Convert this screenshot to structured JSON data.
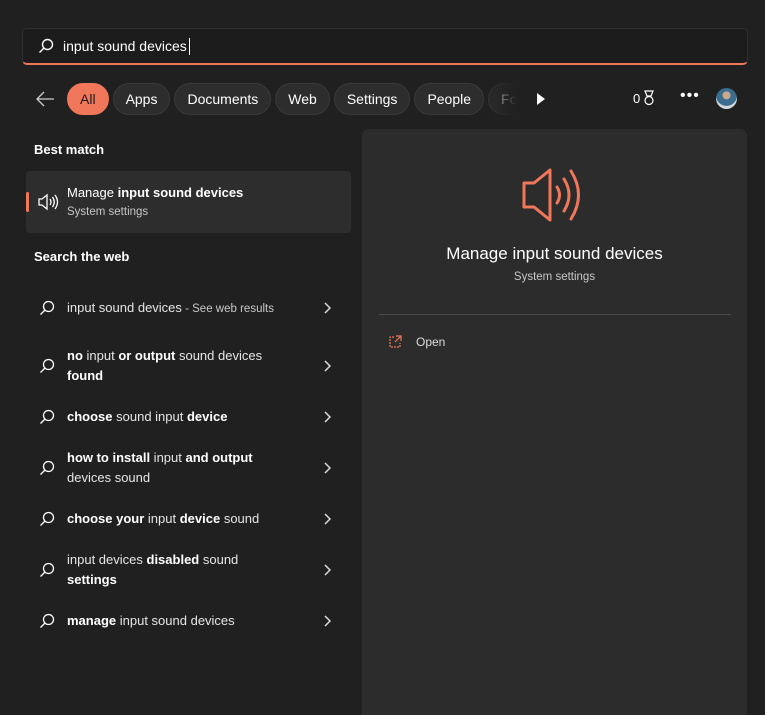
{
  "search": {
    "value": "input sound devices",
    "icon": "search-icon"
  },
  "filters": {
    "chips": [
      "All",
      "Apps",
      "Documents",
      "Web",
      "Settings",
      "People",
      "Folders"
    ],
    "active": "All",
    "rewards_points": "0"
  },
  "best_match": {
    "heading": "Best match",
    "title_prefix": "Manage ",
    "title_bold": "input sound devices",
    "subtitle": "System settings",
    "icon": "speaker-icon"
  },
  "web": {
    "heading": "Search the web",
    "items": [
      {
        "segments": [
          {
            "t": "input sound devices",
            "b": false
          },
          {
            "t": " - See web results",
            "sub": true
          }
        ]
      },
      {
        "segments": [
          {
            "t": "no",
            "b": true
          },
          {
            "t": " input ",
            "b": false
          },
          {
            "t": "or output",
            "b": true
          },
          {
            "t": " sound devices ",
            "b": false
          },
          {
            "t": "found",
            "b": true
          }
        ]
      },
      {
        "segments": [
          {
            "t": "choose",
            "b": true
          },
          {
            "t": " sound input ",
            "b": false
          },
          {
            "t": "device",
            "b": true
          }
        ]
      },
      {
        "segments": [
          {
            "t": "how to install",
            "b": true
          },
          {
            "t": " input ",
            "b": false
          },
          {
            "t": "and output",
            "b": true
          },
          {
            "t": " devices sound",
            "b": false
          }
        ]
      },
      {
        "segments": [
          {
            "t": "choose your",
            "b": true
          },
          {
            "t": " input ",
            "b": false
          },
          {
            "t": "device",
            "b": true
          },
          {
            "t": " sound",
            "b": false
          }
        ]
      },
      {
        "segments": [
          {
            "t": "input devices ",
            "b": false
          },
          {
            "t": "disabled",
            "b": true
          },
          {
            "t": " sound ",
            "b": false
          },
          {
            "t": "settings",
            "b": true
          }
        ]
      },
      {
        "segments": [
          {
            "t": "manage",
            "b": true
          },
          {
            "t": " input sound devices",
            "b": false
          }
        ]
      }
    ]
  },
  "preview": {
    "title": "Manage input sound devices",
    "subtitle": "System settings",
    "actions": [
      {
        "label": "Open",
        "icon": "open-external-icon"
      }
    ]
  },
  "colors": {
    "accent": "#f0775a",
    "background": "#202020",
    "panel": "#2c2c2c"
  }
}
